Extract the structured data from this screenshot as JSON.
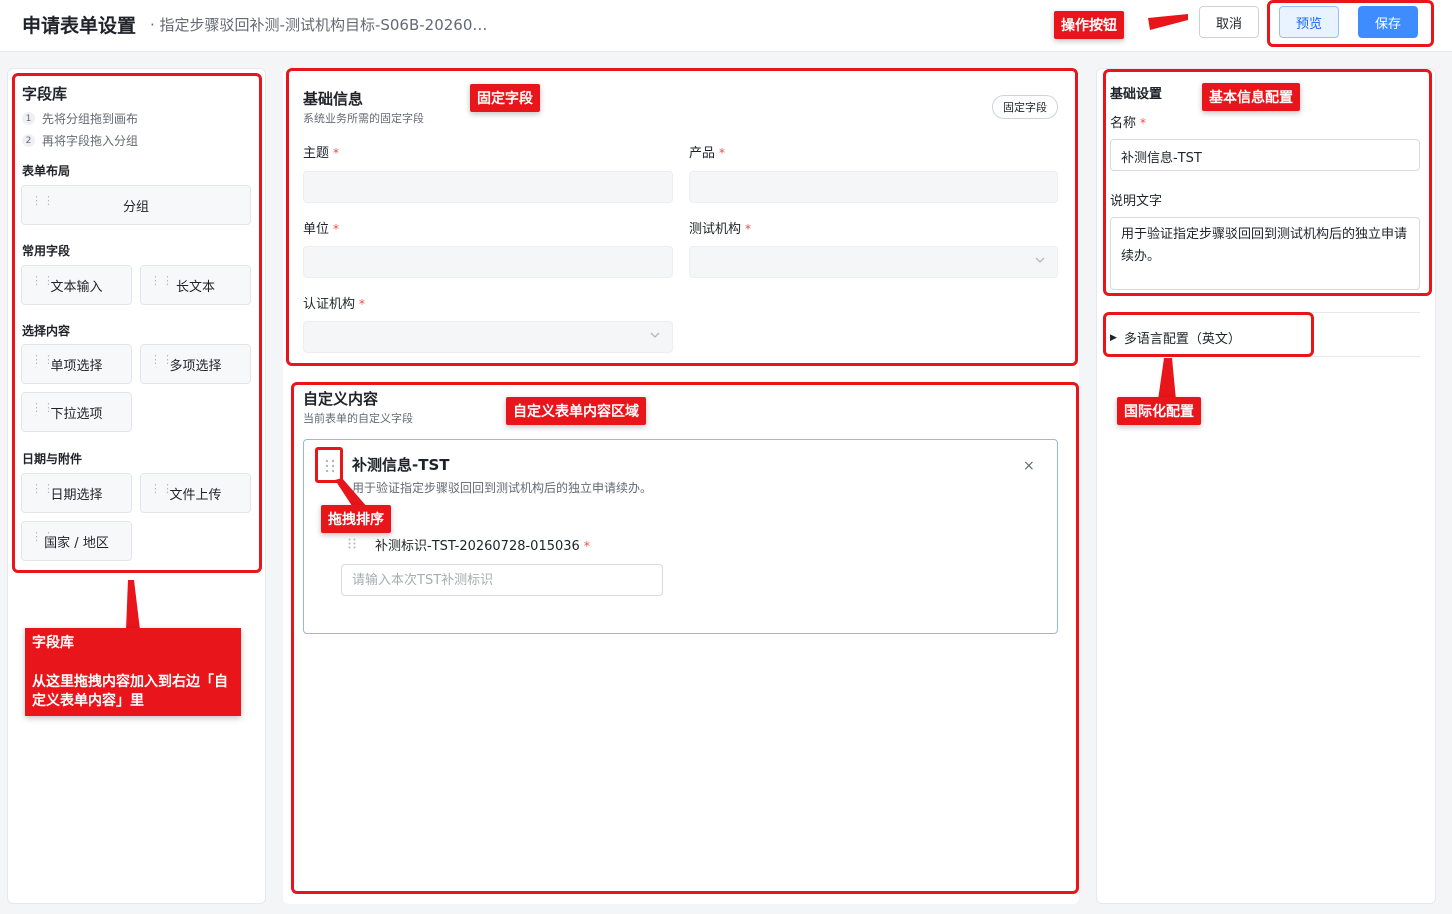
{
  "header": {
    "title": "申请表单设置",
    "subtitle": "· 指定步骤驳回补测-测试机构目标-S06B-20260…",
    "buttons": {
      "cancel": "取消",
      "preview": "预览",
      "save": "保存"
    }
  },
  "field_library": {
    "title": "字段库",
    "steps": [
      {
        "num": "1",
        "text": "先将分组拖到画布"
      },
      {
        "num": "2",
        "text": "再将字段拖入分组"
      }
    ],
    "sections": [
      {
        "label": "表单布局",
        "items": [
          "分组"
        ]
      },
      {
        "label": "常用字段",
        "items": [
          "文本输入",
          "长文本"
        ]
      },
      {
        "label": "选择内容",
        "items": [
          "单项选择",
          "多项选择",
          "下拉选项"
        ]
      },
      {
        "label": "日期与附件",
        "items": [
          "日期选择",
          "文件上传",
          "国家 / 地区"
        ]
      }
    ]
  },
  "basic_info": {
    "title": "基础信息",
    "subtitle": "系统业务所需的固定字段",
    "tag": "固定字段",
    "fields": [
      {
        "label": "主题",
        "required": "*",
        "type": "input"
      },
      {
        "label": "产品",
        "required": "*",
        "type": "input"
      },
      {
        "label": "单位",
        "required": "*",
        "type": "input"
      },
      {
        "label": "测试机构",
        "required": "*",
        "type": "select"
      },
      {
        "label": "认证机构",
        "required": "*",
        "type": "select"
      }
    ]
  },
  "custom_content": {
    "title": "自定义内容",
    "subtitle": "当前表单的自定义字段",
    "group": {
      "title": "补测信息-TST",
      "description": "用于验证指定步骤驳回回到测试机构后的独立申请续办。",
      "close": "×",
      "field": {
        "label": "补测标识-TST-20260728-015036",
        "required": "*",
        "placeholder": "请输入本次TST补测标识"
      }
    }
  },
  "settings": {
    "title": "基础设置",
    "name_label": "名称",
    "name_required": "*",
    "name_value": "补测信息-TST",
    "desc_label": "说明文字",
    "desc_value": "用于验证指定步骤驳回回到测试机构后的独立申请续办。",
    "i18n_label": "多语言配置（英文）"
  },
  "annotations": {
    "action_buttons": "操作按钮",
    "fixed_fields": "固定字段",
    "basic_info_config": "基本信息配置",
    "custom_area": "自定义表单内容区域",
    "drag_sort": "拖拽排序",
    "i18n_config": "国际化配置",
    "library_title": "字段库",
    "library_desc": "从这里拖拽内容加入到右边「自定义表单内容」里"
  },
  "colors": {
    "annotation_red": "#e8151b",
    "primary_blue": "#3f8cff",
    "card_border": "#8fb6ff"
  }
}
